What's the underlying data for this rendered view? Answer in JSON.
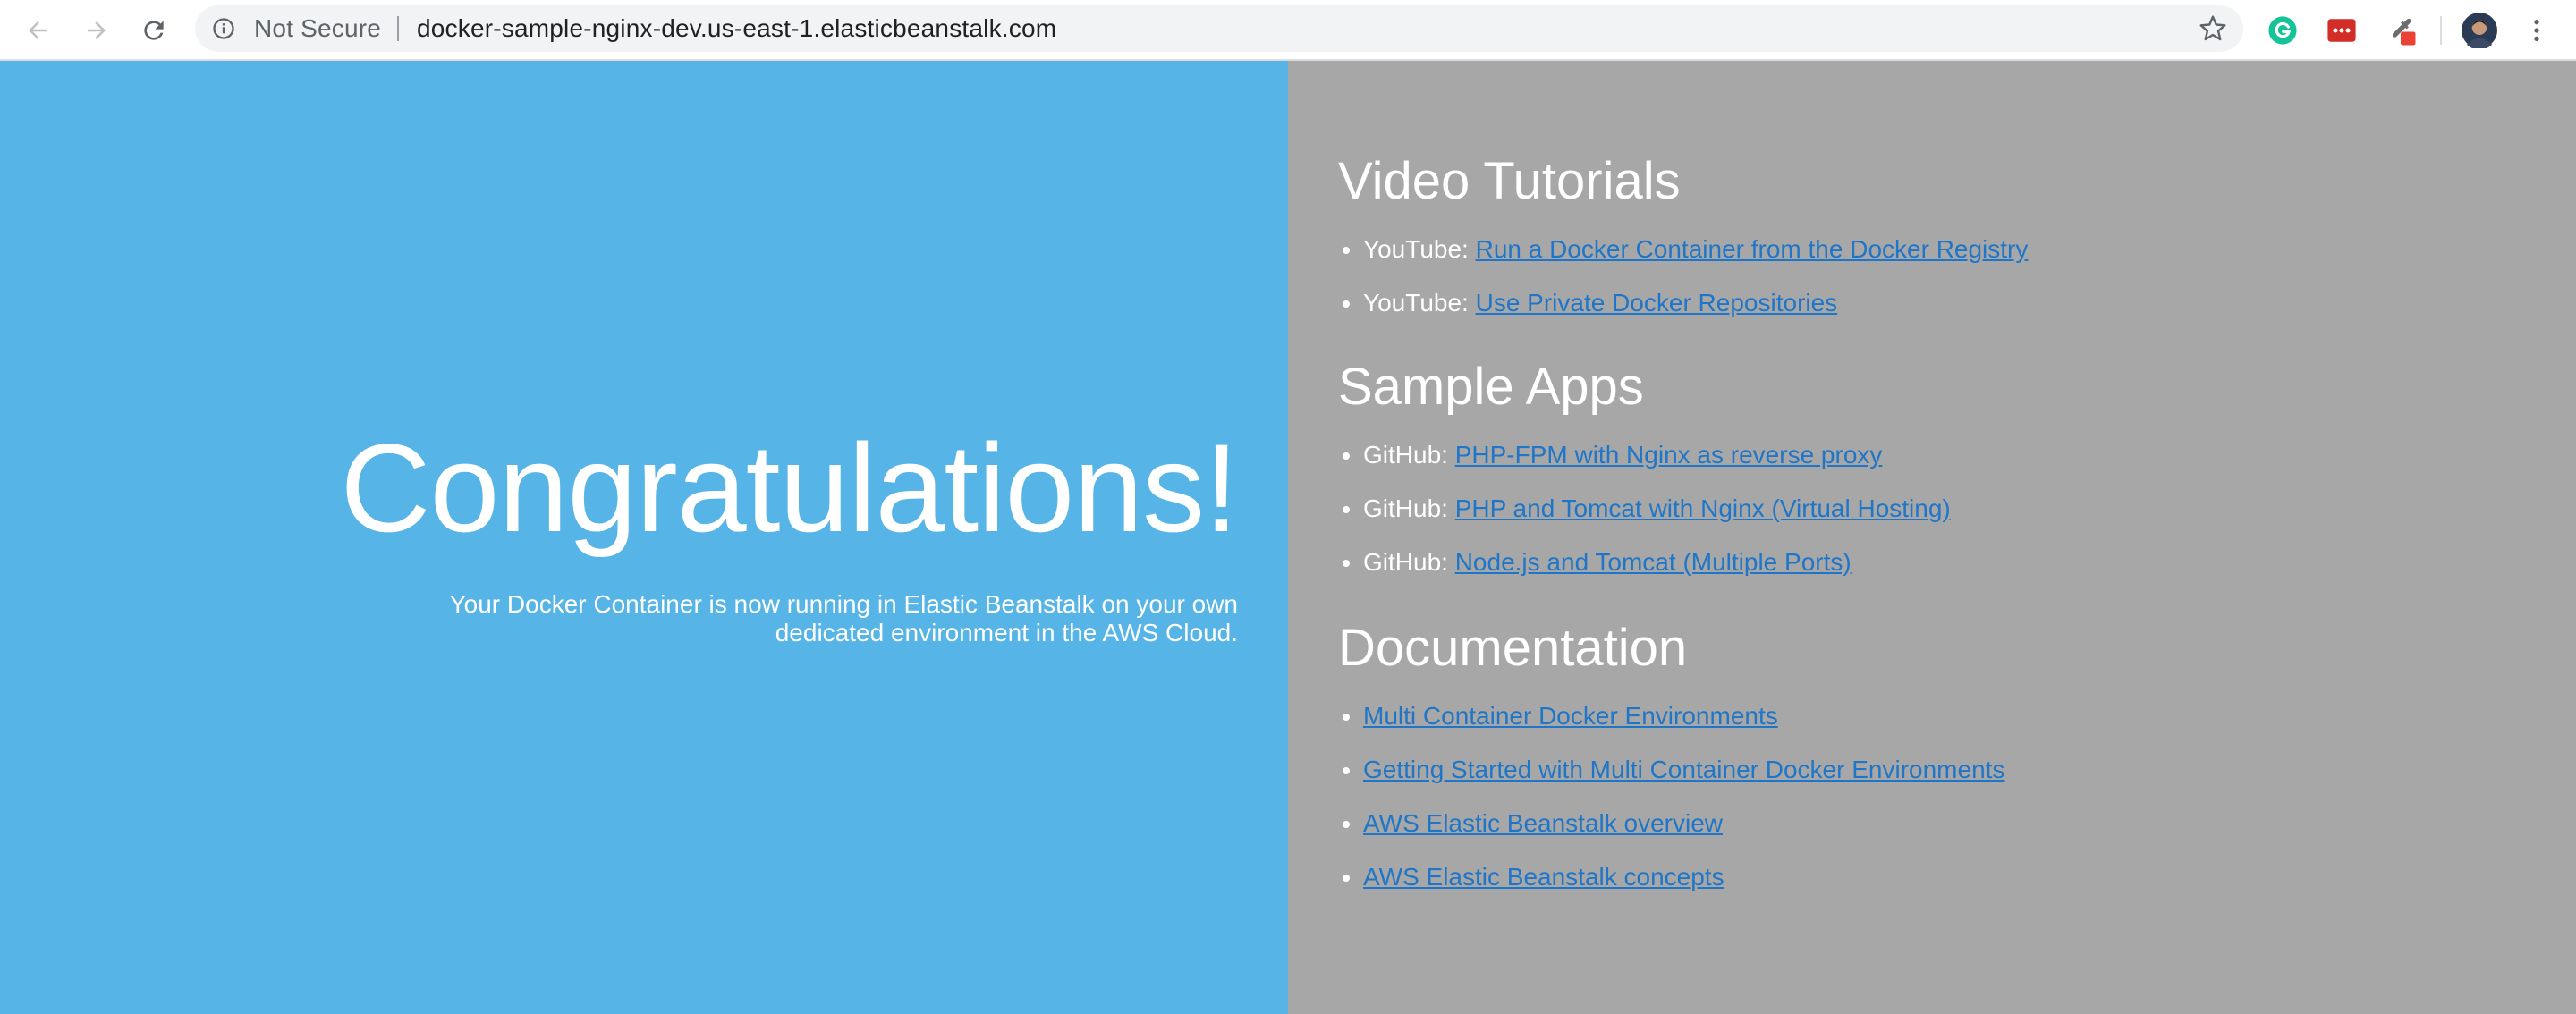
{
  "browser": {
    "security_label": "Not Secure",
    "url": "docker-sample-nginx-dev.us-east-1.elasticbeanstalk.com",
    "icons": {
      "back": "back-arrow-icon",
      "forward": "forward-arrow-icon",
      "reload": "reload-icon",
      "info": "info-icon",
      "bookmark": "star-icon",
      "extensions": [
        "grammarly-icon",
        "lastpass-icon",
        "eyedropper-icon"
      ],
      "profile": "avatar",
      "menu": "kebab-menu-icon"
    },
    "colors": {
      "grammarly": "#15c39a",
      "lastpass": "#d32d27",
      "eyedropper_badge": "#ea4335"
    }
  },
  "hero": {
    "title": "Congratulations!",
    "subtitle": "Your Docker Container is now running in Elastic Beanstalk on your own dedicated environment in the AWS Cloud.",
    "background": "#56b4e6"
  },
  "sidebar": {
    "background": "#a7a7a7",
    "link_color": "#1f76c8",
    "sections": [
      {
        "title": "Video Tutorials",
        "items": [
          {
            "prefix": "YouTube: ",
            "link": "Run a Docker Container from the Docker Registry"
          },
          {
            "prefix": "YouTube: ",
            "link": "Use Private Docker Repositories"
          }
        ]
      },
      {
        "title": "Sample Apps",
        "items": [
          {
            "prefix": "GitHub: ",
            "link": "PHP-FPM with Nginx as reverse proxy"
          },
          {
            "prefix": "GitHub: ",
            "link": "PHP and Tomcat with Nginx (Virtual Hosting)"
          },
          {
            "prefix": "GitHub: ",
            "link": "Node.js and Tomcat (Multiple Ports)"
          }
        ]
      },
      {
        "title": "Documentation",
        "items": [
          {
            "prefix": "",
            "link": "Multi Container Docker Environments"
          },
          {
            "prefix": "",
            "link": "Getting Started with Multi Container Docker Environments"
          },
          {
            "prefix": "",
            "link": "AWS Elastic Beanstalk overview"
          },
          {
            "prefix": "",
            "link": "AWS Elastic Beanstalk concepts"
          }
        ]
      }
    ]
  }
}
